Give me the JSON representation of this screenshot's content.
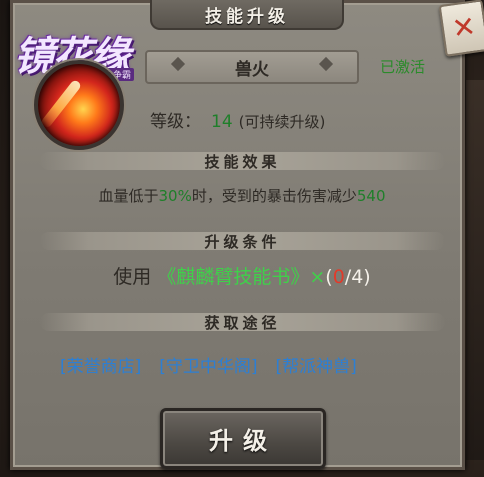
{
  "game": {
    "logo_text": "镜花缘",
    "logo_sub": "风云争霸"
  },
  "dialog": {
    "title": "技能升级",
    "close_icon": "close-x-icon"
  },
  "skill": {
    "icon": "fire-slash-skill-icon",
    "name": "兽火",
    "status": "已激活",
    "level_label": "等级：",
    "level_value": "14",
    "level_note": "(可持续升级)"
  },
  "sections": {
    "effect_title": "技能效果",
    "condition_title": "升级条件",
    "source_title": "获取途径"
  },
  "effect": {
    "prefix": "血量低于",
    "threshold": "30%",
    "middle": "时，受到的暴击伤害减少",
    "reduction": "540"
  },
  "condition": {
    "use_label": "使用",
    "item": "《麒麟臂技能书》",
    "times": "×",
    "paren_open": "(",
    "owned": "0",
    "required": "/4)"
  },
  "sources": [
    {
      "label": "[荣誉商店]"
    },
    {
      "label": "[守卫中华阁]"
    },
    {
      "label": "[帮派神兽]"
    }
  ],
  "actions": {
    "upgrade_label": "升级"
  },
  "colors": {
    "green": "#1f7f2a",
    "book_green": "#3fd04a",
    "link_blue": "#2c7fd4",
    "red": "#e23a2a"
  }
}
